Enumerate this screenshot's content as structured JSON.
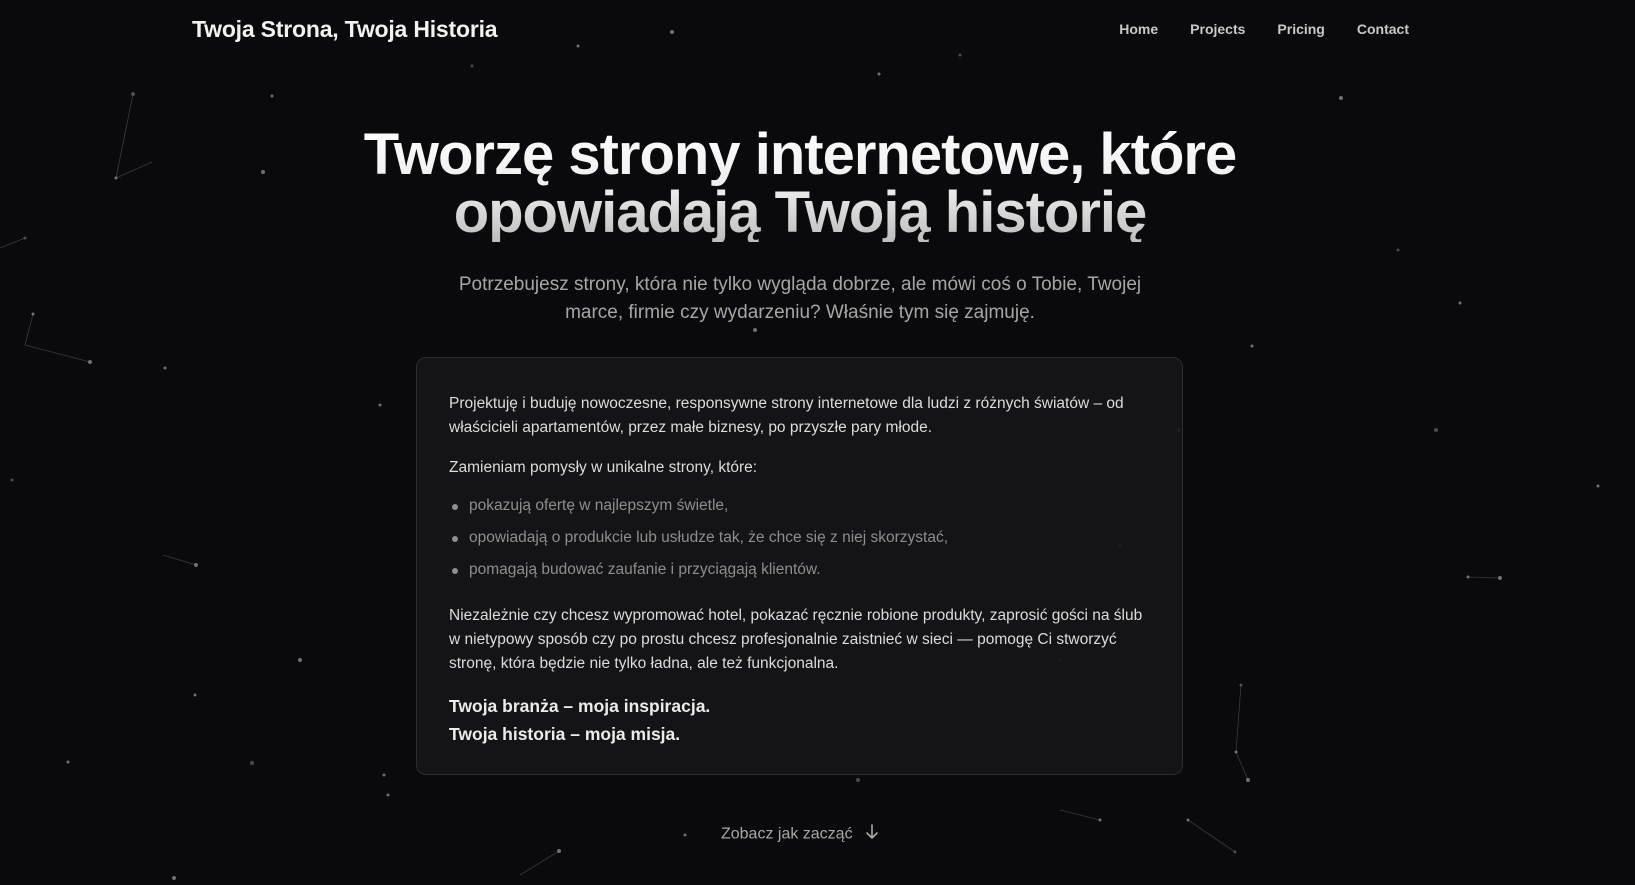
{
  "header": {
    "brand": "Twoja Strona, Twoja Historia",
    "nav": [
      {
        "label": "Home"
      },
      {
        "label": "Projects"
      },
      {
        "label": "Pricing"
      },
      {
        "label": "Contact"
      }
    ]
  },
  "hero": {
    "title_line1": "Tworzę strony internetowe, które",
    "title_line2": "opowiadają Twoją historię",
    "subtitle_line1": "Potrzebujesz strony, która nie tylko wygląda dobrze, ale mówi coś o Tobie, Twojej",
    "subtitle_line2": "marce, firmie czy wydarzeniu? Właśnie tym się zajmuję."
  },
  "card": {
    "intro": "Projektuję i buduję nowoczesne, responsywne strony internetowe dla ludzi z różnych światów – od właścicieli apartamentów, przez małe biznesy, po przyszłe pary młode.",
    "list_lead": "Zamieniam pomysły w unikalne strony, które:",
    "bullets": [
      "pokazują ofertę w najlepszym świetle,",
      "opowiadają o produkcie lub usłudze tak, że chce się z niej skorzystać,",
      "pomagają budować zaufanie i przyciągają klientów."
    ],
    "closing": "Niezależnie czy chcesz wypromować hotel, pokazać ręcznie robione produkty, zaprosić gości na ślub w nietypowy sposób czy po prostu chcesz profesjonalnie zaistnieć w sieci — pomogę Ci stworzyć stronę, która będzie nie tylko ładna, ale też funkcjonalna.",
    "motto_line1": "Twoja branża – moja inspiracja.",
    "motto_line2": "Twoja historia – moja misja."
  },
  "cta": {
    "label": "Zobacz jak zacząć",
    "icon": "arrow-down-icon"
  },
  "colors": {
    "background": "#0a0a0c",
    "card_background": "#161618",
    "card_border": "#2c2c2e",
    "text_primary": "#f2f2f2",
    "text_muted": "#a6a6a6",
    "star": "#8a8a8a"
  }
}
